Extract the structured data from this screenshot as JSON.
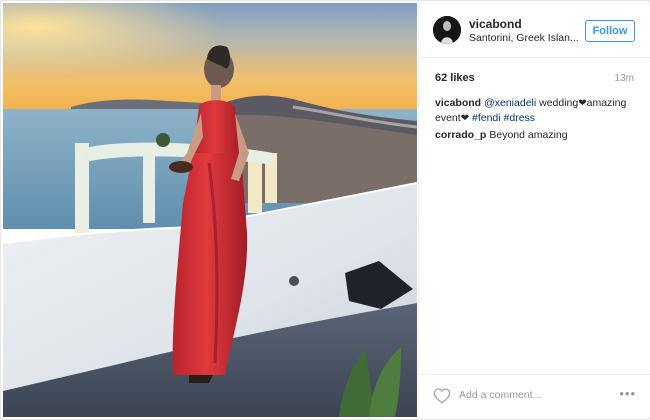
{
  "post": {
    "username": "vicabond",
    "location": "Santorini, Greek Islan...",
    "follow_label": "Follow",
    "likes": "62 likes",
    "time": "13m",
    "comments": [
      {
        "user": "vicabond",
        "mention": "@xeniadeli",
        "text_a": " wedding",
        "text_b": "amazing event",
        "hashtags": "#fendi #dress"
      },
      {
        "user": "corrado_p",
        "text": "Beyond amazing"
      }
    ],
    "add_comment_placeholder": "Add a comment...",
    "more_label": "•••"
  },
  "icons": {
    "like": "heart-outline-icon",
    "more": "more-options-icon",
    "inline_heart": "heart-icon"
  },
  "colors": {
    "follow_blue": "#3897f0",
    "link": "#003569",
    "muted": "#999999",
    "text": "#262626"
  },
  "photo": {
    "description_elements": [
      "sunset-sky",
      "sea",
      "caldera-cliffs",
      "floral-arches",
      "white-terrace-wall",
      "woman-red-dress",
      "speaker",
      "plant"
    ]
  }
}
